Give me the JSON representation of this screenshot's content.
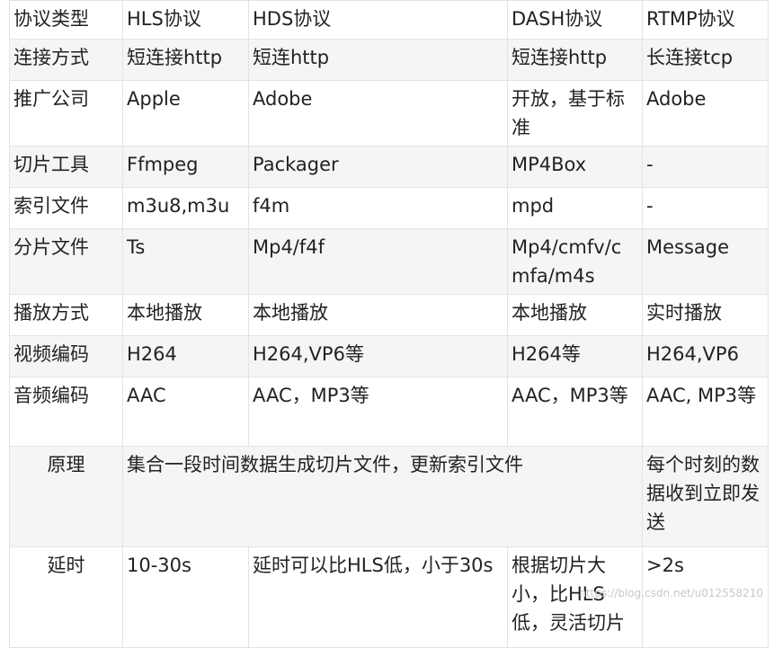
{
  "table": {
    "header": [
      "协议类型",
      "HLS协议",
      "HDS协议",
      "DASH协议",
      "RTMP协议"
    ],
    "rows": [
      [
        "连接方式",
        "短连接http",
        "短连http",
        "短连接http",
        "长连接tcp"
      ],
      [
        "推广公司",
        "Apple",
        "Adobe",
        "开放，基于标准",
        "Adobe"
      ],
      [
        "切片工具",
        "Ffmpeg",
        "Packager",
        "MP4Box",
        "-"
      ],
      [
        "索引文件",
        "m3u8,m3u",
        "f4m",
        "mpd",
        "-"
      ],
      [
        "分片文件",
        "Ts",
        "Mp4/f4f",
        "Mp4/cmfv/cmfa/m4s",
        "Message"
      ],
      [
        "播放方式",
        "本地播放",
        "本地播放",
        "本地播放",
        "实时播放"
      ],
      [
        "视频编码",
        "H264",
        "H264,VP6等",
        "H264等",
        "H264,VP6"
      ],
      [
        "音频编码",
        "AAC",
        "AAC，MP3等",
        "AAC，MP3等",
        "AAC, MP3等"
      ]
    ],
    "principle": {
      "label": "原理",
      "merged": "集合一段时间数据生成切片文件，更新索引文件",
      "rtmp": "每个时刻的数据收到立即发送"
    },
    "latency": {
      "label": "延时",
      "hls": "10-30s",
      "hds": "延时可以比HLS低，小于30s",
      "dash": "根据切片大小，比HLS低，灵活切片",
      "rtmp": ">2s"
    }
  },
  "watermark": "https://blog.csdn.net/u012558210"
}
